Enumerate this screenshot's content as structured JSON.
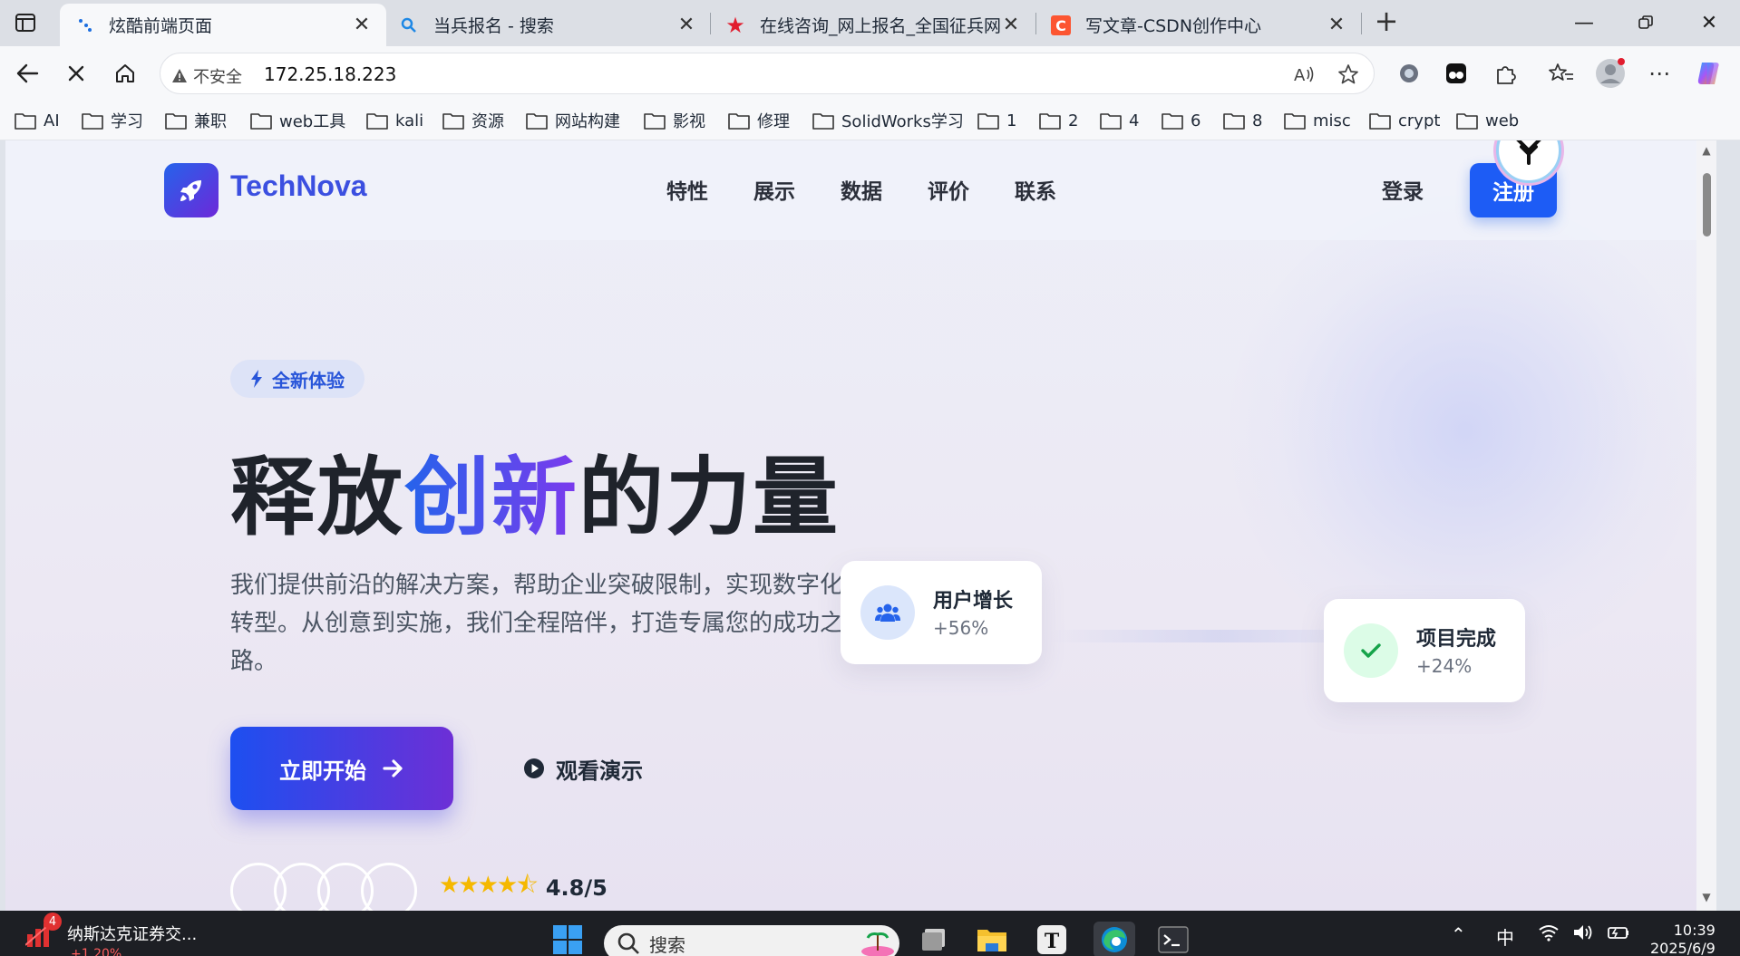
{
  "browser": {
    "tabs": [
      {
        "title": "炫酷前端页面",
        "active": true
      },
      {
        "title": "当兵报名 - 搜索",
        "active": false
      },
      {
        "title": "在线咨询_网上报名_全国征兵网",
        "active": false
      },
      {
        "title": "写文章-CSDN创作中心",
        "active": false
      }
    ],
    "address": {
      "security_label": "不安全",
      "url": "172.25.18.223"
    },
    "bookmarks": [
      "AI",
      "学习",
      "兼职",
      "web工具",
      "kali",
      "资源",
      "网站构建",
      "影视",
      "修理",
      "SolidWorks学习",
      "1",
      "2",
      "4",
      "6",
      "8",
      "misc",
      "crypt",
      "web"
    ]
  },
  "site": {
    "brand": "TechNova",
    "nav": [
      "特性",
      "展示",
      "数据",
      "评价",
      "联系"
    ],
    "login": "登录",
    "signup": "注册",
    "hero": {
      "pill": "全新体验",
      "headline_pre": "释放",
      "headline_accent": "创新",
      "headline_post": "的力量",
      "description": "我们提供前沿的解决方案，帮助企业突破限制，实现数字化转型。从创意到实施，我们全程陪伴，打造专属您的成功之路。",
      "primary_cta": "立即开始",
      "secondary_cta": "观看演示",
      "rating": "4.8/5"
    },
    "stats": [
      {
        "label": "用户增长",
        "value": "+56%"
      },
      {
        "label": "项目完成",
        "value": "+24%"
      }
    ]
  },
  "taskbar": {
    "news_title": "纳斯达克证券交...",
    "news_sub": "+1.20%",
    "news_badge": "4",
    "search_placeholder": "搜索",
    "ime": "中",
    "time": "10:39",
    "date": "2025/6/9"
  },
  "colors": {
    "accent": "#1d5cf5",
    "brand": "#3b4fe0",
    "star": "#f5b800",
    "success": "#16a34a"
  }
}
